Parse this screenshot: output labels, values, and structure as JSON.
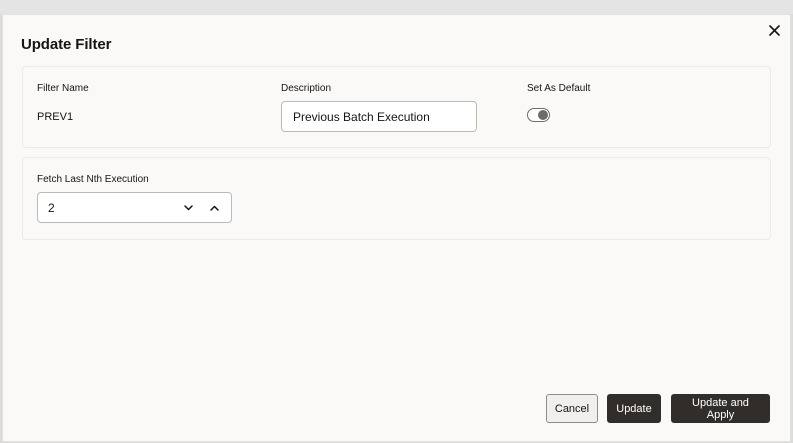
{
  "dialog": {
    "title": "Update Filter",
    "close_icon": "close-icon"
  },
  "filter_section": {
    "filter_name_label": "Filter Name",
    "filter_name_value": "PREV1",
    "description_label": "Description",
    "description_value": "Previous Batch Execution",
    "default_label": "Set As Default",
    "default_on": false
  },
  "execution_section": {
    "label": "Fetch Last Nth Execution",
    "value": "2",
    "decrement_icon": "chevron-down-icon",
    "increment_icon": "chevron-up-icon"
  },
  "footer": {
    "cancel_label": "Cancel",
    "update_label": "Update",
    "update_apply_label": "Update and Apply"
  },
  "colors": {
    "primary_button": "#312d2a",
    "dialog_background": "#fbf9f8"
  }
}
